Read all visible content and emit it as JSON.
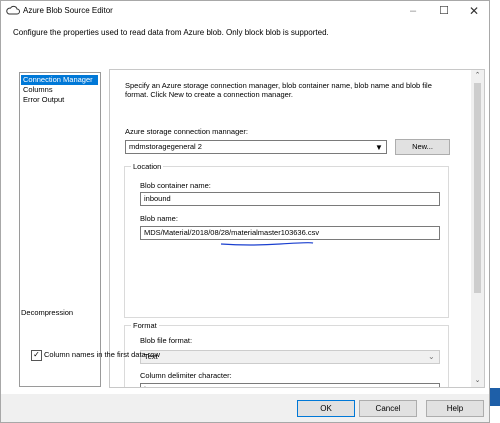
{
  "window": {
    "title": "Azure Blob Source Editor",
    "description": "Configure the properties used to read data from Azure blob. Only block blob is supported."
  },
  "nav": {
    "items": [
      {
        "label": "Connection Manager",
        "selected": true
      },
      {
        "label": "Columns",
        "selected": false
      },
      {
        "label": "Error Output",
        "selected": false
      }
    ]
  },
  "content": {
    "intro": "Specify an Azure storage connection manager, blob container name, blob name and blob file format. Click New to create a connection manager.",
    "connection": {
      "label": "Azure storage connection mannager:",
      "value": "mdmstoragegeneral 2",
      "new_button": "New..."
    },
    "location": {
      "title": "Location",
      "container_label": "Blob container name:",
      "container_value": "inbound",
      "blob_label": "Blob name:",
      "blob_value": "MDS/Material/2018/08/28/materialmaster103636.csv"
    },
    "format": {
      "title": "Format",
      "file_format_label": "Blob file format:",
      "file_format_value": "Text",
      "delimiter_label": "Column delimiter character:",
      "delimiter_value": "|",
      "column_names_label": "Column names in the first data row",
      "column_names_checked": true
    },
    "decompression": {
      "title": "Decompression"
    }
  },
  "footer": {
    "ok": "OK",
    "cancel": "Cancel",
    "help": "Help"
  },
  "colors": {
    "accent": "#0078d7",
    "annotation_underline": "#1a3fcf"
  },
  "icons": {
    "title": "cloud-icon",
    "dropdown": "chevron-down-icon",
    "checkbox": "check-icon"
  }
}
